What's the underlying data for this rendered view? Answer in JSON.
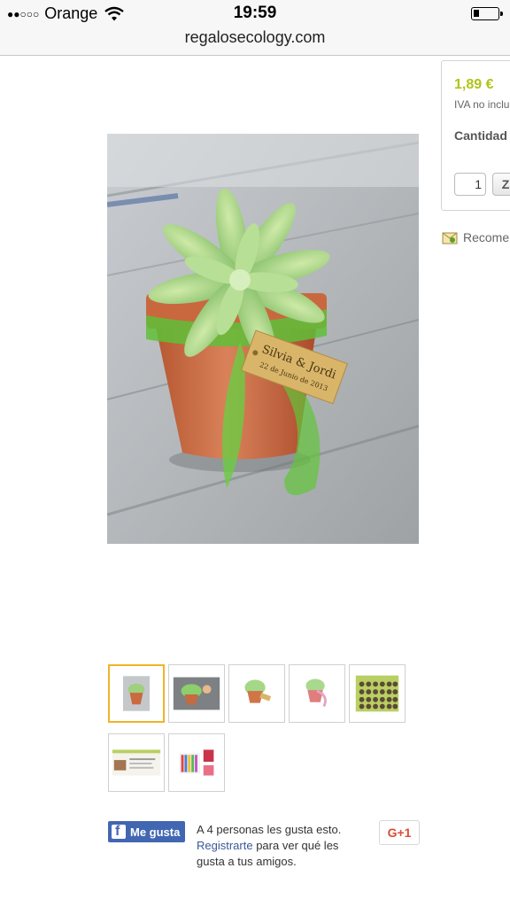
{
  "status_bar": {
    "signal": "●●○○○",
    "carrier": "Orange",
    "time": "19:59",
    "battery_level": 0.25
  },
  "browser": {
    "url": "regalosecology.com"
  },
  "product_panel": {
    "price": "1,89 €",
    "tax_note": "IVA no inclu",
    "quantity_label": "Cantidad",
    "quantity_value": "1",
    "add_button_label": "Z"
  },
  "recommend_label": "Recome",
  "product_image": {
    "tag_line1": "Silvia & Jordi",
    "tag_line2": "22 de Junio de 2013"
  },
  "social": {
    "fb_button_label": "Me gusta",
    "fb_text_pre": "A 4 personas les gusta esto.",
    "fb_link": "Registrarte",
    "fb_text_post": "para ver qué les gusta a tus amigos.",
    "gplus_label": "G+1"
  },
  "colors": {
    "price": "#b1c417",
    "facebook": "#4267b2",
    "gplus": "#dd4b39",
    "thumb_selected_border": "#f0b429"
  }
}
